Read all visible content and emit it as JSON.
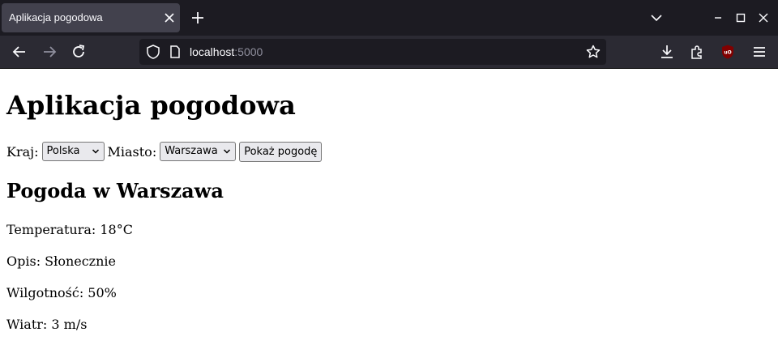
{
  "browser": {
    "tab_title": "Aplikacja pogodowa",
    "url_host": "localhost",
    "url_port": ":5000",
    "accent_color": "#1c1b22",
    "icons": [
      "close-icon",
      "plus-icon",
      "chevron-down-icon",
      "minimize-icon",
      "maximize-icon",
      "window-close-icon",
      "back-arrow-icon",
      "forward-arrow-icon",
      "reload-icon",
      "shield-icon",
      "page-icon",
      "star-icon",
      "download-icon",
      "extensions-icon",
      "ublock-icon",
      "hamburger-menu-icon"
    ]
  },
  "page": {
    "heading": "Aplikacja pogodowa",
    "form": {
      "country_label": "Kraj:",
      "country_value": "Polska",
      "city_label": "Miasto:",
      "city_value": "Warszawa",
      "submit_label": "Pokaż pogodę"
    },
    "weather": {
      "title": "Pogoda w Warszawa",
      "temperature": "Temperatura: 18°C",
      "description": "Opis: Słonecznie",
      "humidity": "Wilgotność: 50%",
      "wind": "Wiatr: 3 m/s"
    }
  }
}
